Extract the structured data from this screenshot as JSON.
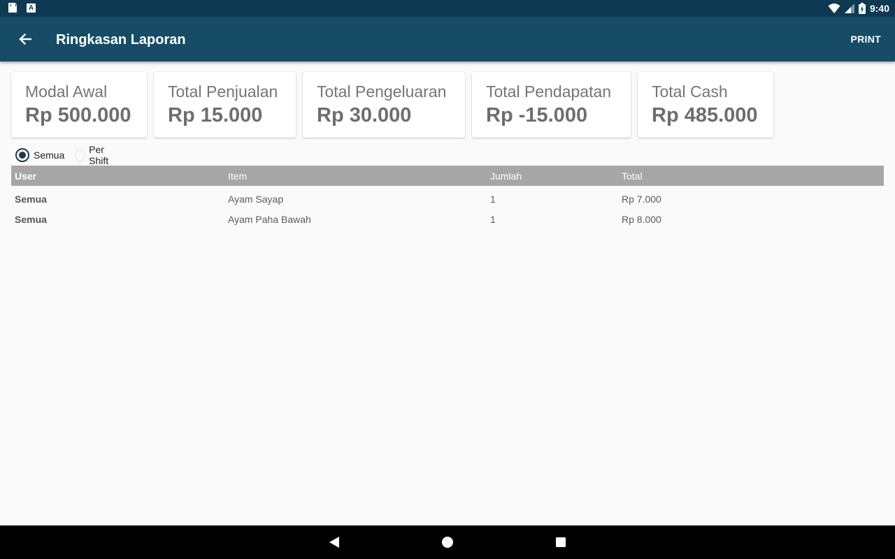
{
  "status_bar": {
    "time": "9:40",
    "left_icons": [
      "sd-card-icon",
      "keyboard-a-icon"
    ],
    "right_icons": [
      "wifi-icon",
      "cell-signal-icon",
      "battery-charging-icon"
    ]
  },
  "app_bar": {
    "title": "Ringkasan Laporan",
    "print_label": "PRINT",
    "back_icon": "arrow-left-icon",
    "color": "#164c66"
  },
  "cards": [
    {
      "label": "Modal Awal",
      "value": "Rp 500.000"
    },
    {
      "label": "Total Penjualan",
      "value": "Rp 15.000"
    },
    {
      "label": "Total Pengeluaran",
      "value": "Rp 30.000"
    },
    {
      "label": "Total Pendapatan",
      "value": "Rp -15.000"
    },
    {
      "label": "Total Cash",
      "value": "Rp 485.000"
    }
  ],
  "filter": {
    "options": [
      {
        "label": "Semua",
        "selected": true
      },
      {
        "label": "Per Shift",
        "selected": false
      }
    ]
  },
  "table": {
    "headers": {
      "user": "User",
      "item": "Item",
      "jumlah": "Jumlah",
      "total": "Total"
    },
    "rows": [
      {
        "user": "Semua",
        "item": "Ayam Sayap",
        "jumlah": "1",
        "total": "Rp 7.000"
      },
      {
        "user": "Semua",
        "item": "Ayam Paha Bawah",
        "jumlah": "1",
        "total": "Rp 8.000"
      }
    ]
  },
  "nav_bar": {
    "icons": [
      "nav-back-icon",
      "nav-home-icon",
      "nav-recents-icon"
    ]
  }
}
